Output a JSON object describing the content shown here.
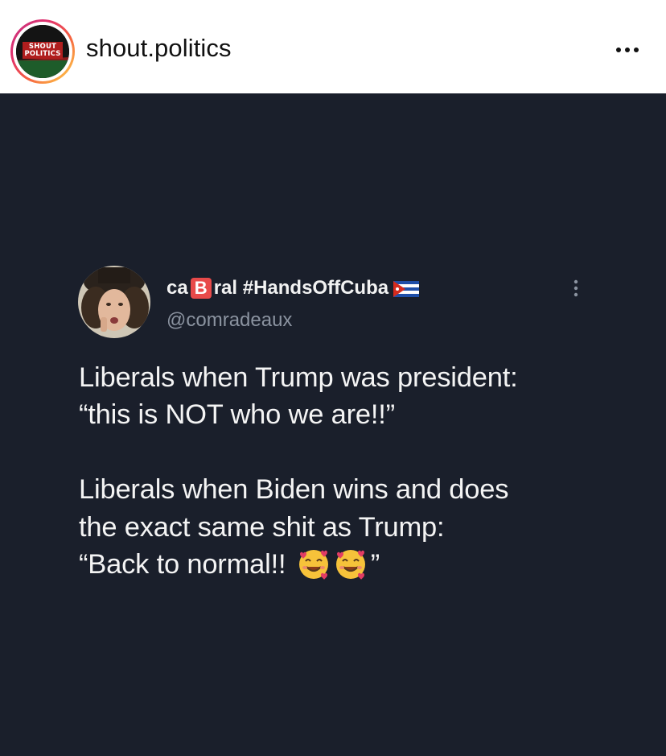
{
  "header": {
    "account_name": "shout.politics",
    "avatar_logo": {
      "line1": "SHOUT",
      "line2": "POLITICS"
    },
    "more_icon": "more-horizontal-icon"
  },
  "tweet": {
    "display_name_part1": "ca",
    "display_name_letter": "B",
    "display_name_part2": "ral #HandsOffCuba",
    "flag_icon": "cuba-flag-icon",
    "handle": "@comradeaux",
    "menu_icon": "more-vertical-icon",
    "lines": [
      "Liberals when Trump was president:",
      "“this is NOT who we are!!”",
      "Liberals when Biden wins and does",
      "the exact same shit as Trump:",
      "“Back to normal!! "
    ],
    "closing_quote": "”",
    "emoji_icons": [
      "smiling-face-with-hearts-icon",
      "smiling-face-with-hearts-icon"
    ]
  },
  "colors": {
    "post_background": "#1a1f2b",
    "text_primary": "#f4f4f4",
    "text_secondary": "#8b93a0",
    "story_ring": "#e1306c"
  }
}
